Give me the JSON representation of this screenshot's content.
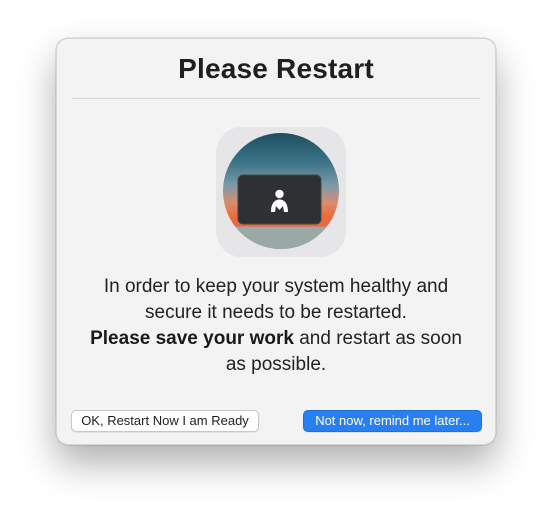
{
  "dialog": {
    "title": "Please Restart",
    "icon": "laptop-with-user-icon",
    "message_line1": "In order to keep your system healthy and",
    "message_line2": "secure it needs to be restarted.",
    "message_bold": "Please save your work",
    "message_line3_rest": " and restart as soon",
    "message_line4": "as possible.",
    "buttons": {
      "restart_now": "OK, Restart Now I am Ready",
      "remind_later": "Not now, remind me later..."
    }
  },
  "colors": {
    "dialog_background": "#f3f3f3",
    "primary_button": "#2a7ff0",
    "title_text": "#1f1f1f"
  }
}
